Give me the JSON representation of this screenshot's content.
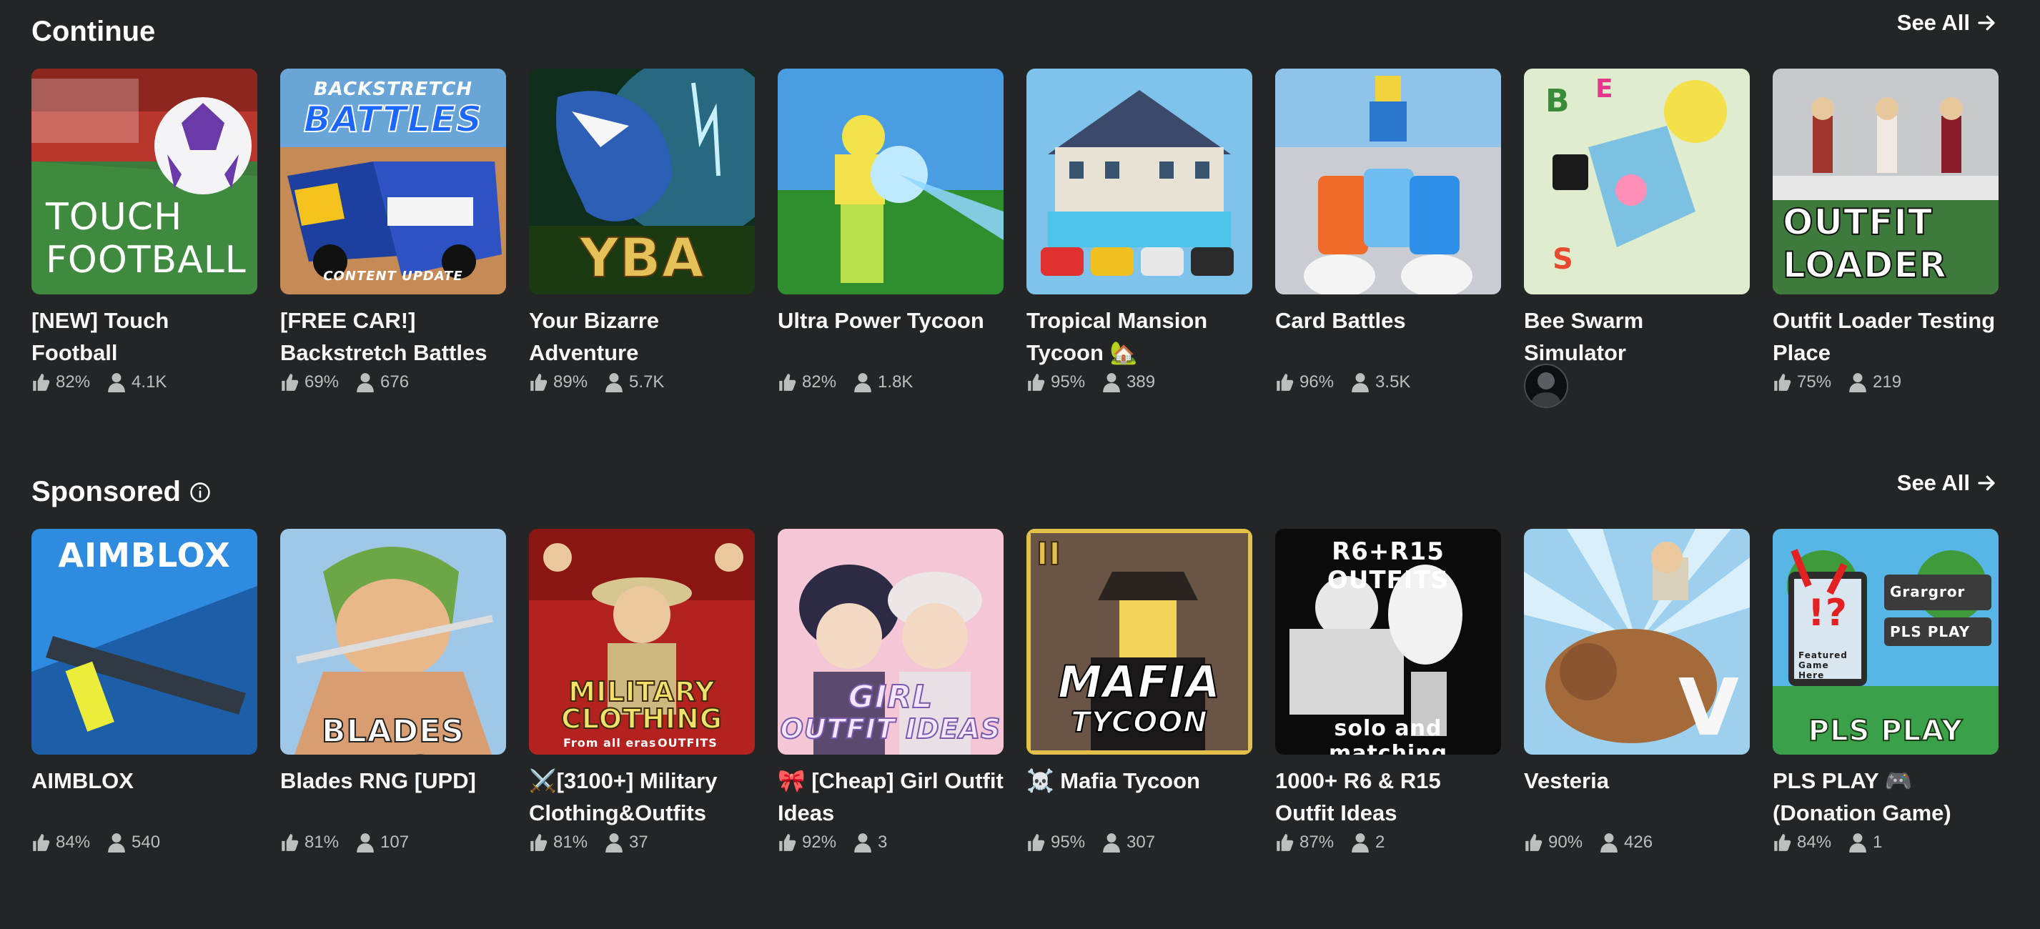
{
  "continue": {
    "title": "Continue",
    "see_all": "See All",
    "games": [
      {
        "name": "[NEW] Touch Football",
        "rating": "82%",
        "players": "4.1K",
        "thumb_text": [
          "TOUCH",
          "FOOTBALL"
        ]
      },
      {
        "name": "[FREE CAR!] Backstretch Battles",
        "rating": "69%",
        "players": "676",
        "thumb_text": [
          "BACKSTRETCH",
          "BATTLES",
          "CONTENT UPDATE"
        ]
      },
      {
        "name": "Your Bizarre Adventure",
        "rating": "89%",
        "players": "5.7K",
        "thumb_text": [
          "YBA"
        ]
      },
      {
        "name": "Ultra Power Tycoon",
        "rating": "82%",
        "players": "1.8K",
        "thumb_text": []
      },
      {
        "name": "Tropical Mansion Tycoon 🏡",
        "rating": "95%",
        "players": "389",
        "thumb_text": []
      },
      {
        "name": "Card Battles",
        "rating": "96%",
        "players": "3.5K",
        "thumb_text": []
      },
      {
        "name": "Bee Swarm Simulator",
        "rating": null,
        "players": null,
        "thumb_text": []
      },
      {
        "name": "Outfit Loader Testing Place",
        "rating": "75%",
        "players": "219",
        "thumb_text": [
          "OUTFIT",
          "LOADER"
        ]
      }
    ]
  },
  "sponsored": {
    "title": "Sponsored",
    "see_all": "See All",
    "games": [
      {
        "name": "AIMBLOX",
        "rating": "84%",
        "players": "540",
        "thumb_text": [
          "AIMBLOX"
        ]
      },
      {
        "name": "Blades RNG [UPD]",
        "rating": "81%",
        "players": "107",
        "thumb_text": [
          "BLADES RNG"
        ]
      },
      {
        "name": "⚔️[3100+] Military Clothing&Outfits",
        "rating": "81%",
        "players": "37",
        "thumb_text": [
          "MILITARY",
          "CLOTHING",
          "From all eras",
          "OUTFITS"
        ]
      },
      {
        "name": "🎀 [Cheap] Girl Outfit Ideas",
        "rating": "92%",
        "players": "3",
        "thumb_text": [
          "GIRL",
          "OUTFIT IDEAS"
        ]
      },
      {
        "name": "☠️ Mafia Tycoon",
        "rating": "95%",
        "players": "307",
        "thumb_text": [
          "II",
          "MAFIA",
          "TYCOON"
        ]
      },
      {
        "name": "1000+ R6 & R15 Outfit Ideas",
        "rating": "87%",
        "players": "2",
        "thumb_text": [
          "R6+R15 OUTFITS",
          "solo and matching"
        ]
      },
      {
        "name": "Vesteria",
        "rating": "90%",
        "players": "426",
        "thumb_text": [
          "V"
        ]
      },
      {
        "name": "PLS PLAY 🎮 (Donation Game)",
        "rating": "84%",
        "players": "1",
        "thumb_text": [
          "!?",
          "Grargror",
          "PLS PLAY",
          "Featured Game Here",
          "PLS PLAY"
        ]
      }
    ]
  },
  "colors": {
    "background": "#232527",
    "text": "#f7f7f8",
    "meta_text": "#bdbebe"
  },
  "icons": {
    "thumb": "thumbs-up-icon",
    "players": "person-icon",
    "arrow": "arrow-right-icon",
    "info": "info-icon"
  }
}
